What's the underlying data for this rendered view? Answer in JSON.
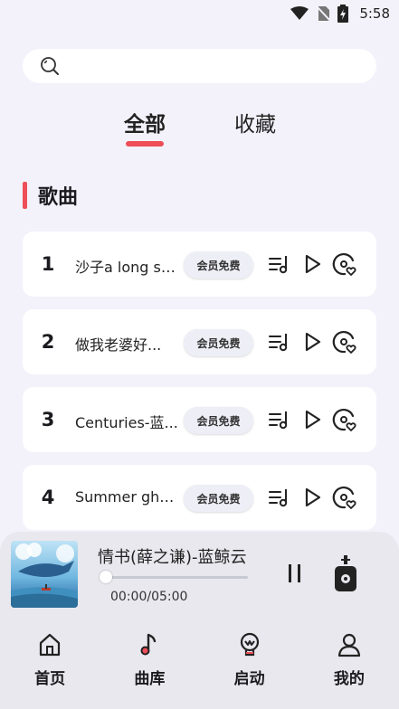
{
  "status_bar": {
    "time": "5:58",
    "icons": [
      "wifi-icon",
      "no-sim-icon",
      "battery-icon"
    ]
  },
  "search": {
    "placeholder": "",
    "value": ""
  },
  "tabs": [
    {
      "label": "全部",
      "active": true
    },
    {
      "label": "收藏",
      "active": false
    }
  ],
  "section": {
    "title": "歌曲"
  },
  "songs": [
    {
      "index": "1",
      "title": "沙子a long st...",
      "badge": "会员免费"
    },
    {
      "index": "2",
      "title": "做我老婆好...",
      "badge": "会员免费"
    },
    {
      "index": "3",
      "title": "Centuries-蓝...",
      "badge": "会员免费"
    },
    {
      "index": "4",
      "title": "Summer gho...",
      "badge": "会员免费"
    }
  ],
  "player": {
    "title": "情书(薛之谦)-蓝鲸云",
    "time": "00:00/05:00",
    "progress": 0
  },
  "nav": [
    {
      "label": "首页",
      "icon": "home-icon"
    },
    {
      "label": "曲库",
      "icon": "music-note-icon"
    },
    {
      "label": "启动",
      "icon": "launch-icon"
    },
    {
      "label": "我的",
      "icon": "user-icon"
    }
  ],
  "colors": {
    "accent": "#ee4e57",
    "background": "#f3f2fb",
    "card": "#ffffff"
  }
}
